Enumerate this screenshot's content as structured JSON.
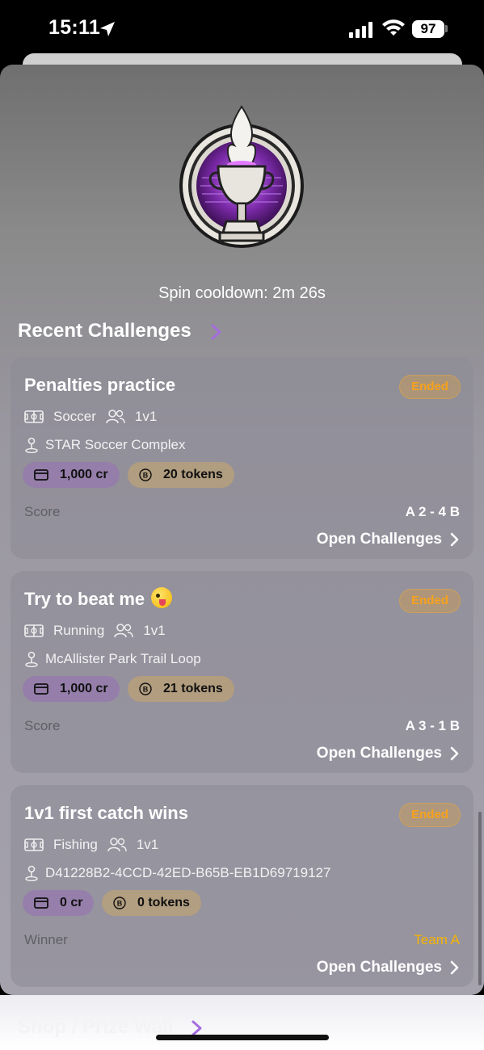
{
  "status_bar": {
    "time": "15:11",
    "battery": "97"
  },
  "wheel": {
    "cooldown_text": "Spin cooldown: 2m 26s"
  },
  "sections": {
    "recent_challenges": "Recent Challenges",
    "shop": "Shop / Prize Wall"
  },
  "challenges": [
    {
      "title": "Penalties practice",
      "status": "Ended",
      "sport": "Soccer",
      "format": "1v1",
      "location": "STAR Soccer Complex",
      "credits": "1,000 cr",
      "tokens": "20 tokens",
      "result_label": "Score",
      "result_value": "A 2 - 4 B",
      "link": "Open Challenges"
    },
    {
      "title": "Try to beat me",
      "status": "Ended",
      "sport": "Running",
      "format": "1v1",
      "location": "McAllister Park Trail Loop",
      "credits": "1,000 cr",
      "tokens": "21 tokens",
      "result_label": "Score",
      "result_value": "A 3 - 1 B",
      "link": "Open Challenges"
    },
    {
      "title": "1v1 first catch wins",
      "status": "Ended",
      "sport": "Fishing",
      "format": "1v1",
      "location": "D41228B2-4CCD-42ED-B65B-EB1D69719127",
      "credits": "0 cr",
      "tokens": "0 tokens",
      "result_label": "Winner",
      "result_value": "Team A",
      "link": "Open Challenges"
    }
  ],
  "colors": {
    "badge_text": "#f7a21c",
    "winner": "#f5b301",
    "accent": "#a56de0"
  }
}
